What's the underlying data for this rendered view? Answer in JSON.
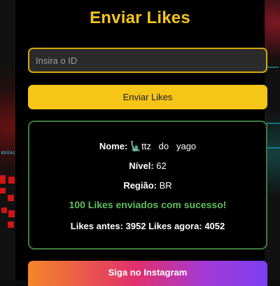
{
  "header": {
    "title": "Enviar Likes"
  },
  "form": {
    "id_placeholder": "Insira o ID",
    "id_value": "",
    "send_label": "Enviar Likes"
  },
  "result": {
    "name_label": "Nome:",
    "name_value": "🗽ttz   do   yago",
    "level_label": "Nível:",
    "level_value": "62",
    "region_label": "Região:",
    "region_value": "BR",
    "success_message": "100 Likes enviados com sucesso!",
    "likes_before_label": "Likes antes:",
    "likes_before_value": "3952",
    "likes_after_label": "Likes agora:",
    "likes_after_value": "4052"
  },
  "footer": {
    "instagram_label": "Siga no Instagram"
  },
  "background": {
    "side_text": "BREACH"
  },
  "colors": {
    "accent": "#f5c518",
    "panel": "#000000",
    "success": "#5fbf5f",
    "result_border": "#3f7a3f",
    "instagram_start": "#f58529",
    "instagram_end": "#7b3ff2"
  }
}
